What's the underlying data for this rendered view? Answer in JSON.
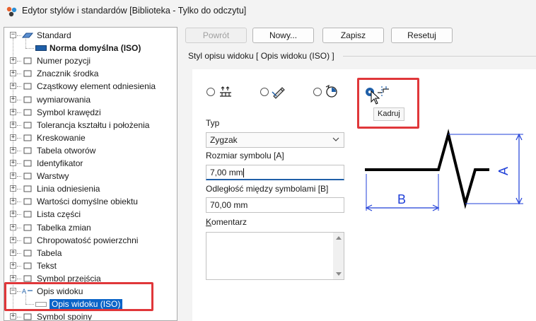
{
  "window": {
    "title": "Edytor stylów i standardów [Biblioteka - Tylko do odczytu]",
    "app_icon": "app-logo-icon"
  },
  "tree": {
    "items": [
      {
        "label": "Standard",
        "icon": "standard-icon",
        "expander": "−"
      },
      {
        "label": "Norma domyślna (ISO)",
        "icon": "norm-icon"
      },
      {
        "label": "Numer pozycji",
        "icon": "balloon-icon",
        "expander": "+"
      },
      {
        "label": "Znacznik środka",
        "icon": "center-mark-icon",
        "expander": "+"
      },
      {
        "label": "Cząstkowy element odniesienia",
        "icon": "datum-target-icon",
        "expander": "+"
      },
      {
        "label": "wymiarowania",
        "icon": "dimension-icon",
        "expander": "+"
      },
      {
        "label": "Symbol krawędzi",
        "icon": "edge-symbol-icon",
        "expander": "+"
      },
      {
        "label": "Tolerancja kształtu i położenia",
        "icon": "feature-control-icon",
        "expander": "+"
      },
      {
        "label": "Kreskowanie",
        "icon": "hatch-icon",
        "expander": "+"
      },
      {
        "label": "Tabela otworów",
        "icon": "hole-table-icon",
        "expander": "+"
      },
      {
        "label": "Identyfikator",
        "icon": "identifier-icon",
        "expander": "+"
      },
      {
        "label": "Warstwy",
        "icon": "layers-icon",
        "expander": "+"
      },
      {
        "label": "Linia odniesienia",
        "icon": "leader-icon",
        "expander": "+"
      },
      {
        "label": "Wartości domyślne obiektu",
        "icon": "object-defaults-icon",
        "expander": "+"
      },
      {
        "label": "Lista części",
        "icon": "parts-list-icon",
        "expander": "+"
      },
      {
        "label": "Tabelka zmian",
        "icon": "revision-table-icon",
        "expander": "+"
      },
      {
        "label": "Chropowatość powierzchni",
        "icon": "surface-texture-icon",
        "expander": "+"
      },
      {
        "label": "Tabela",
        "icon": "table-icon",
        "expander": "+"
      },
      {
        "label": "Tekst",
        "icon": "text-icon",
        "expander": "+"
      },
      {
        "label": "Symbol przejścia",
        "icon": "transition-symbol-icon",
        "expander": "+"
      },
      {
        "label": "Opis widoku",
        "icon": "view-annotation-icon",
        "expander": "−"
      },
      {
        "label": "Opis widoku (ISO)",
        "icon": "view-annotation-style-icon"
      },
      {
        "label": "Symbol spoiny",
        "icon": "weld-symbol-icon",
        "expander": "+"
      }
    ]
  },
  "toolbar": {
    "back": "Powrót",
    "new": "Nowy...",
    "save": "Zapisz",
    "reset": "Resetuj"
  },
  "style_panel": {
    "title": "Styl opisu widoku [ Opis widoku (ISO) ]",
    "options": [
      {
        "icon": "view-label-option-icon",
        "checked": false
      },
      {
        "icon": "detail-label-option-icon",
        "checked": false
      },
      {
        "icon": "rotation-option-icon",
        "checked": false
      },
      {
        "icon": "break-option-icon",
        "checked": true
      }
    ],
    "tooltip": "Kadruj",
    "type_label": "Typ",
    "type_value": "Zygzak",
    "symbol_size_label": "Rozmiar symbolu [A]",
    "symbol_size_value": "7,00 mm",
    "spacing_label": "Odległość między symbolami [B]",
    "spacing_value": "70,00 mm",
    "comment_label": "Komentarz",
    "comment_underline": "K",
    "comment_rest": "omentarz",
    "preview": {
      "a": "A",
      "b": "B"
    }
  },
  "colors": {
    "accent": "#1f5fa8",
    "highlight": "#e0373a",
    "selection": "#0a64c8",
    "dimension_blue": "#1f3fd8"
  }
}
